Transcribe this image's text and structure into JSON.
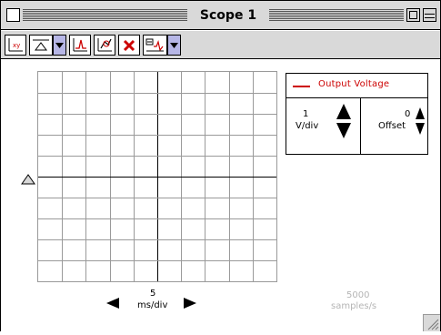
{
  "window": {
    "title": "Scope 1"
  },
  "toolbar": {
    "tools": [
      {
        "name": "xy-mode-icon"
      },
      {
        "name": "trigger-icon"
      },
      {
        "name": "trigger-dropdown"
      },
      {
        "name": "smooth-icon"
      },
      {
        "name": "analysis-icon"
      },
      {
        "name": "delete-icon"
      },
      {
        "name": "channel-icon"
      },
      {
        "name": "channel-dropdown"
      }
    ]
  },
  "channel_panel": {
    "legend_label": "Output Voltage",
    "legend_color": "#cc0000",
    "volts_per_div_value": "1",
    "volts_per_div_unit": "V/div",
    "offset_value": "0",
    "offset_label": "Offset"
  },
  "timebase": {
    "value": "5",
    "unit": "ms/div"
  },
  "sample_rate": {
    "value": "5000",
    "unit": "samples/s"
  },
  "colors": {
    "titlebar": "#d9d9d9",
    "dropdown": "#b6b6e6",
    "grid_line": "#9a9a9a",
    "trace": "#cc0000",
    "disabled_text": "#b5b5b5"
  }
}
